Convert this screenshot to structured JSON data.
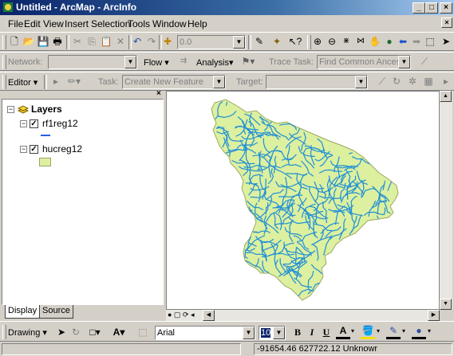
{
  "window": {
    "title": "Untitled - ArcMap - ArcInfo"
  },
  "menubar": {
    "items": [
      {
        "label": "File"
      },
      {
        "label": "Edit"
      },
      {
        "label": "View"
      },
      {
        "label": "Insert"
      },
      {
        "label": "Selection"
      },
      {
        "label": "Tools"
      },
      {
        "label": "Window"
      },
      {
        "label": "Help"
      }
    ]
  },
  "standard_toolbar": {
    "scale_value": "0.0"
  },
  "network_toolbar": {
    "network_label": "Network:",
    "flow_label": "Flow",
    "analysis_label": "Analysis",
    "trace_task_label": "Trace Task:",
    "trace_task_value": "Find Common Ancesto"
  },
  "editor_toolbar": {
    "editor_label": "Editor",
    "task_label": "Task:",
    "task_value": "Create New Feature",
    "target_label": "Target:"
  },
  "toc": {
    "root_label": "Layers",
    "layers": [
      {
        "name": "rf1reg12",
        "checked": true,
        "symbol": "line",
        "color": "#1f64e0"
      },
      {
        "name": "hucreg12",
        "checked": true,
        "symbol": "polygon",
        "color": "#dcf0a0"
      }
    ],
    "tabs": [
      {
        "label": "Display"
      },
      {
        "label": "Source"
      }
    ]
  },
  "map": {
    "polygon_fill": "#dcf0a0",
    "polygon_stroke": "#9aa860",
    "stream_color": "#1f8fd6"
  },
  "drawing_toolbar": {
    "drawing_label": "Drawing",
    "font_name": "Arial",
    "font_size": "10",
    "bold": "B",
    "italic": "I",
    "underline": "U",
    "font_color_glyph": "A",
    "text_tool_glyph": "A"
  },
  "statusbar": {
    "coordinates": "-91654.46  627722.12 Unknowr"
  },
  "colors": {
    "title_start": "#0a246a",
    "title_end": "#a6caf0",
    "chrome": "#d4d0c8"
  }
}
